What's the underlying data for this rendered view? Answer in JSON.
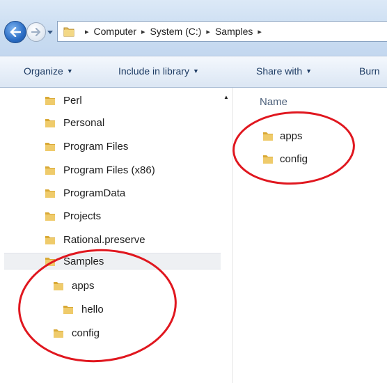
{
  "address_bar": {
    "crumbs": [
      "Computer",
      "System (C:)",
      "Samples"
    ],
    "separator": "▸"
  },
  "toolbar": {
    "organize": "Organize",
    "include_in_library": "Include in library",
    "share_with": "Share with",
    "burn": "Burn"
  },
  "nav_tree": {
    "items": [
      {
        "label": "Perl"
      },
      {
        "label": "Personal"
      },
      {
        "label": "Program Files"
      },
      {
        "label": "Program Files (x86)"
      },
      {
        "label": "ProgramData"
      },
      {
        "label": "Projects"
      },
      {
        "label": "Rational.preserve"
      },
      {
        "label": "Samples",
        "selected": true
      },
      {
        "label": "apps"
      },
      {
        "label": "hello"
      },
      {
        "label": "config"
      }
    ]
  },
  "content": {
    "column_header": "Name",
    "items": [
      {
        "label": "apps"
      },
      {
        "label": "config"
      }
    ]
  },
  "colors": {
    "annotation_circle": "#e0171f",
    "folder": "#e8c36a",
    "toolbar_text": "#1e3c64"
  },
  "icons": {
    "back": "back-arrow-icon",
    "forward": "forward-arrow-icon",
    "folder": "folder-icon",
    "dropdown": "chevron-down-icon",
    "scroll_up": "scroll-up-arrow-icon"
  }
}
